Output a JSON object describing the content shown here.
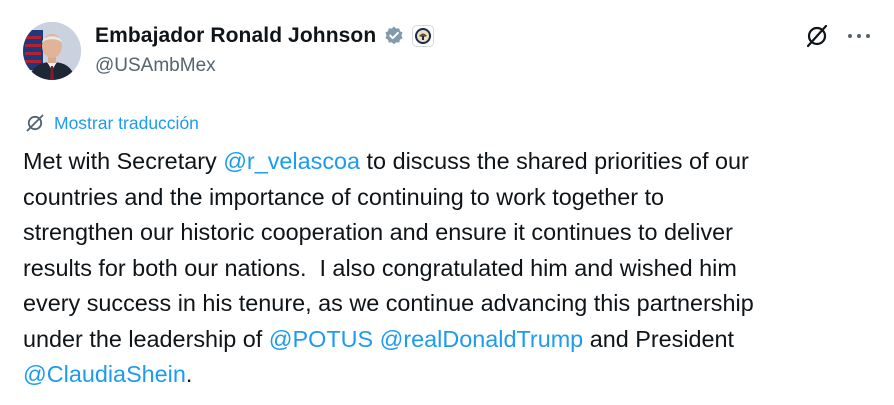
{
  "author": {
    "display_name": "Embajador Ronald Johnson",
    "handle": "@USAmbMex",
    "verified_icon": "verified-badge-icon",
    "affiliation_icon": "state-department-seal-icon"
  },
  "actions": {
    "grok_icon": "grok-icon",
    "more_icon": "more-options-icon"
  },
  "translate": {
    "icon": "translate-grok-icon",
    "label": "Mostrar traducción"
  },
  "tweet": {
    "line1": {
      "a": "Met with Secretary ",
      "mention": "@r_velascoa",
      "b": " to discuss the shared priorities of our"
    },
    "line2": "countries and the importance of continuing to work together to",
    "line3": "strengthen our historic cooperation and ensure it continues to deliver",
    "line4": "results for both our nations.  I also congratulated him and wished him",
    "line5": "every success in his tenure, as we continue advancing this partnership",
    "line6": {
      "a": "under the leadership of ",
      "mention1": "@POTUS",
      "sep": " ",
      "mention2": "@realDonaldTrump",
      "b": " and President"
    },
    "line7": {
      "mention": "@ClaudiaShein",
      "b": "."
    }
  },
  "colors": {
    "link": "#1d9bf0",
    "text": "#0f1419",
    "secondary": "#536471",
    "verified": "#829aab"
  }
}
